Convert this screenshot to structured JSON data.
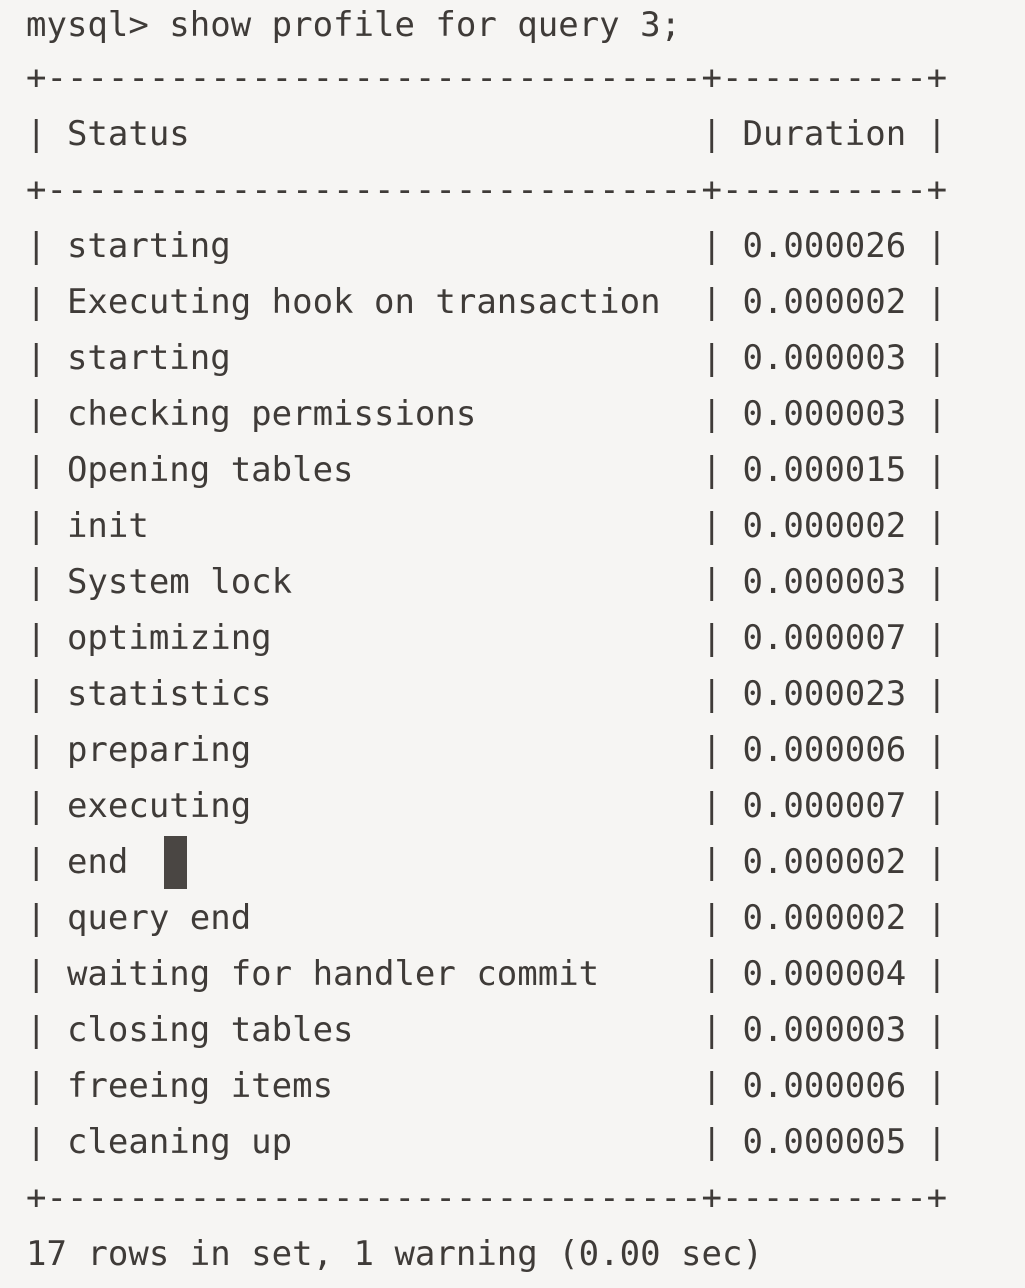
{
  "terminal": {
    "prompt": "mysql> ",
    "command": "show profile for query 3;",
    "prompt_line": "mysql> show profile for query 3;",
    "separator": "+--------------------------------+----------+",
    "header_line": "| Status                         | Duration |",
    "footer_status": "17 rows in set, 1 warning (0.00 sec)",
    "colors": {
      "background": "#f6f5f3",
      "foreground": "#3f3b38",
      "cursor": "#4a4643"
    },
    "cursor": {
      "visible": true,
      "row_index": 11,
      "column": 6,
      "glyph": "block"
    }
  },
  "table": {
    "columns": [
      {
        "name": "Status",
        "width": 30
      },
      {
        "name": "Duration",
        "width": 8
      }
    ],
    "row_count": 17,
    "rows": [
      {
        "status": "starting",
        "duration": "0.000026"
      },
      {
        "status": "Executing hook on transaction",
        "duration": "0.000002"
      },
      {
        "status": "starting",
        "duration": "0.000003"
      },
      {
        "status": "checking permissions",
        "duration": "0.000003"
      },
      {
        "status": "Opening tables",
        "duration": "0.000015"
      },
      {
        "status": "init",
        "duration": "0.000002"
      },
      {
        "status": "System lock",
        "duration": "0.000003"
      },
      {
        "status": "optimizing",
        "duration": "0.000007"
      },
      {
        "status": "statistics",
        "duration": "0.000023"
      },
      {
        "status": "preparing",
        "duration": "0.000006"
      },
      {
        "status": "executing",
        "duration": "0.000007"
      },
      {
        "status": "end",
        "duration": "0.000002"
      },
      {
        "status": "query end",
        "duration": "0.000002"
      },
      {
        "status": "waiting for handler commit",
        "duration": "0.000004"
      },
      {
        "status": "closing tables",
        "duration": "0.000003"
      },
      {
        "status": "freeing items",
        "duration": "0.000006"
      },
      {
        "status": "cleaning up",
        "duration": "0.000005"
      }
    ]
  }
}
